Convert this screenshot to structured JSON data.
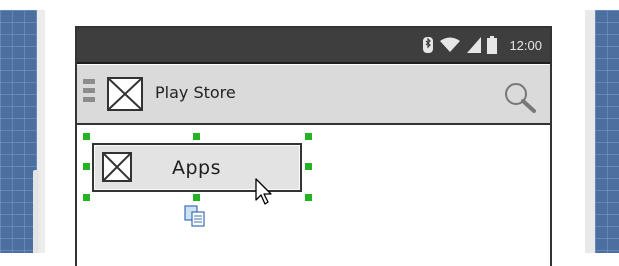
{
  "status_bar": {
    "time": "12:00",
    "icons": [
      "bluetooth-icon",
      "wifi-icon",
      "signal-icon",
      "battery-icon"
    ]
  },
  "app_bar": {
    "title": "Play Store",
    "icons": [
      "hamburger-menu-icon",
      "image-placeholder-icon",
      "search-icon"
    ]
  },
  "canvas": {
    "selected_widget": {
      "label": "Apps",
      "icon": "image-placeholder-icon",
      "handle_color": "#22b422"
    },
    "floating_icons": [
      "copy-icon"
    ]
  },
  "colors": {
    "status_bar": "#3e3e3e",
    "app_bar": "#dadada",
    "grid": "#4c6fa0",
    "selection": "#22b422"
  }
}
